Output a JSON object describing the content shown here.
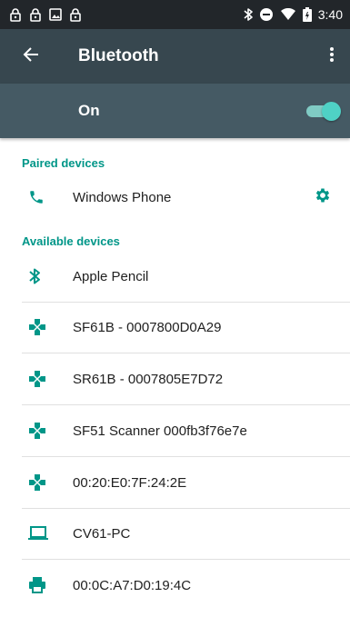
{
  "status_bar": {
    "time": "3:40",
    "left_icons": [
      "lock-icon",
      "lock-icon",
      "image-icon",
      "lock-icon"
    ],
    "right_icons": [
      "bluetooth-icon",
      "do-not-disturb-icon",
      "wifi-icon",
      "battery-icon"
    ]
  },
  "app_bar": {
    "title": "Bluetooth",
    "back_icon": "arrow-back-icon",
    "menu_icon": "more-vert-icon"
  },
  "master_switch": {
    "label": "On",
    "state": true
  },
  "paired": {
    "header": "Paired devices",
    "devices": [
      {
        "name": "Windows Phone",
        "icon": "phone-icon",
        "action_icon": "settings-gear-icon"
      }
    ]
  },
  "available": {
    "header": "Available devices",
    "devices": [
      {
        "name": "Apple Pencil",
        "icon": "bluetooth-icon"
      },
      {
        "name": "SF61B - 0007800D0A29",
        "icon": "gamepad-icon"
      },
      {
        "name": "SR61B - 0007805E7D72",
        "icon": "gamepad-icon"
      },
      {
        "name": "SF51 Scanner 000fb3f76e7e",
        "icon": "gamepad-icon"
      },
      {
        "name": "00:20:E0:7F:24:2E",
        "icon": "gamepad-icon"
      },
      {
        "name": "CV61-PC",
        "icon": "laptop-icon"
      },
      {
        "name": "00:0C:A7:D0:19:4C",
        "icon": "printer-icon"
      }
    ]
  },
  "colors": {
    "status_bar": "#22262a",
    "app_bar": "#37474f",
    "switch_bar": "#455a64",
    "accent": "#009688",
    "text_primary": "#212121"
  }
}
